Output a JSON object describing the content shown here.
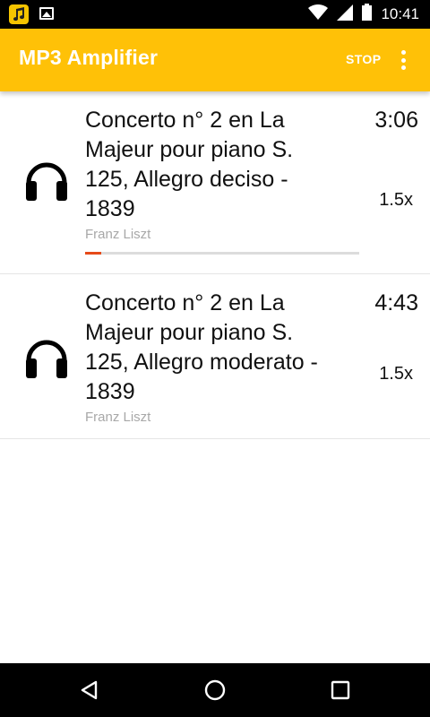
{
  "status_bar": {
    "time": "10:41",
    "icons": [
      "music-note-icon",
      "image-icon",
      "wifi-icon",
      "cell-signal-icon",
      "battery-icon"
    ]
  },
  "app_bar": {
    "title": "MP3 Amplifier",
    "stop_label": "STOP",
    "background_color": "#ffc107",
    "overflow_icon": "more-vert-icon"
  },
  "tracks": [
    {
      "title_lines": [
        "Concerto n° 2 en La",
        "Majeur pour piano  S.",
        "125, Allegro deciso -",
        "1839"
      ],
      "artist": "Franz Liszt",
      "duration": "3:06",
      "speed": "1.5x",
      "icon": "headphones-icon",
      "progress_fraction": 0.06
    },
    {
      "title_lines": [
        "Concerto n° 2 en La",
        "Majeur pour piano  S.",
        "125, Allegro moderato -",
        "1839"
      ],
      "artist": "Franz Liszt",
      "duration": "4:43",
      "speed": "1.5x",
      "icon": "headphones-icon"
    }
  ],
  "nav_bar": {
    "buttons": [
      "back-icon",
      "home-icon",
      "recents-icon"
    ]
  },
  "colors": {
    "accent": "#ffc107",
    "progress": "#e64a19",
    "artist_text": "#a8a8a8"
  }
}
